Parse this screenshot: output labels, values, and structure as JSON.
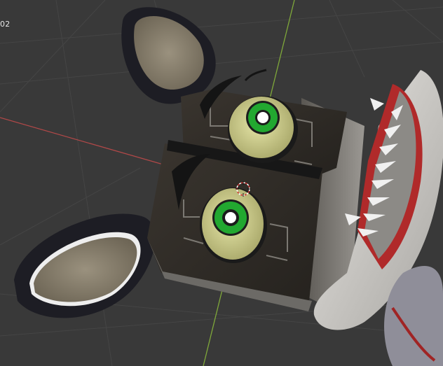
{
  "viewport": {
    "overlay_text": "02",
    "colors": {
      "background": "#393939",
      "grid_line": "#444444",
      "x_axis": "#b04848",
      "y_axis": "#7fa83a",
      "body_dark": "#2f2b26",
      "fur_gray": "#d2d0cc",
      "ear_inner": "#8c8270",
      "ear_outer": "#1c1c22",
      "eye_sclera": "#d6d690",
      "iris": "#22a830",
      "pupil": "#ffffff",
      "mouth_red": "#b02a2a"
    },
    "icons": [
      "3d-cursor-icon"
    ]
  }
}
